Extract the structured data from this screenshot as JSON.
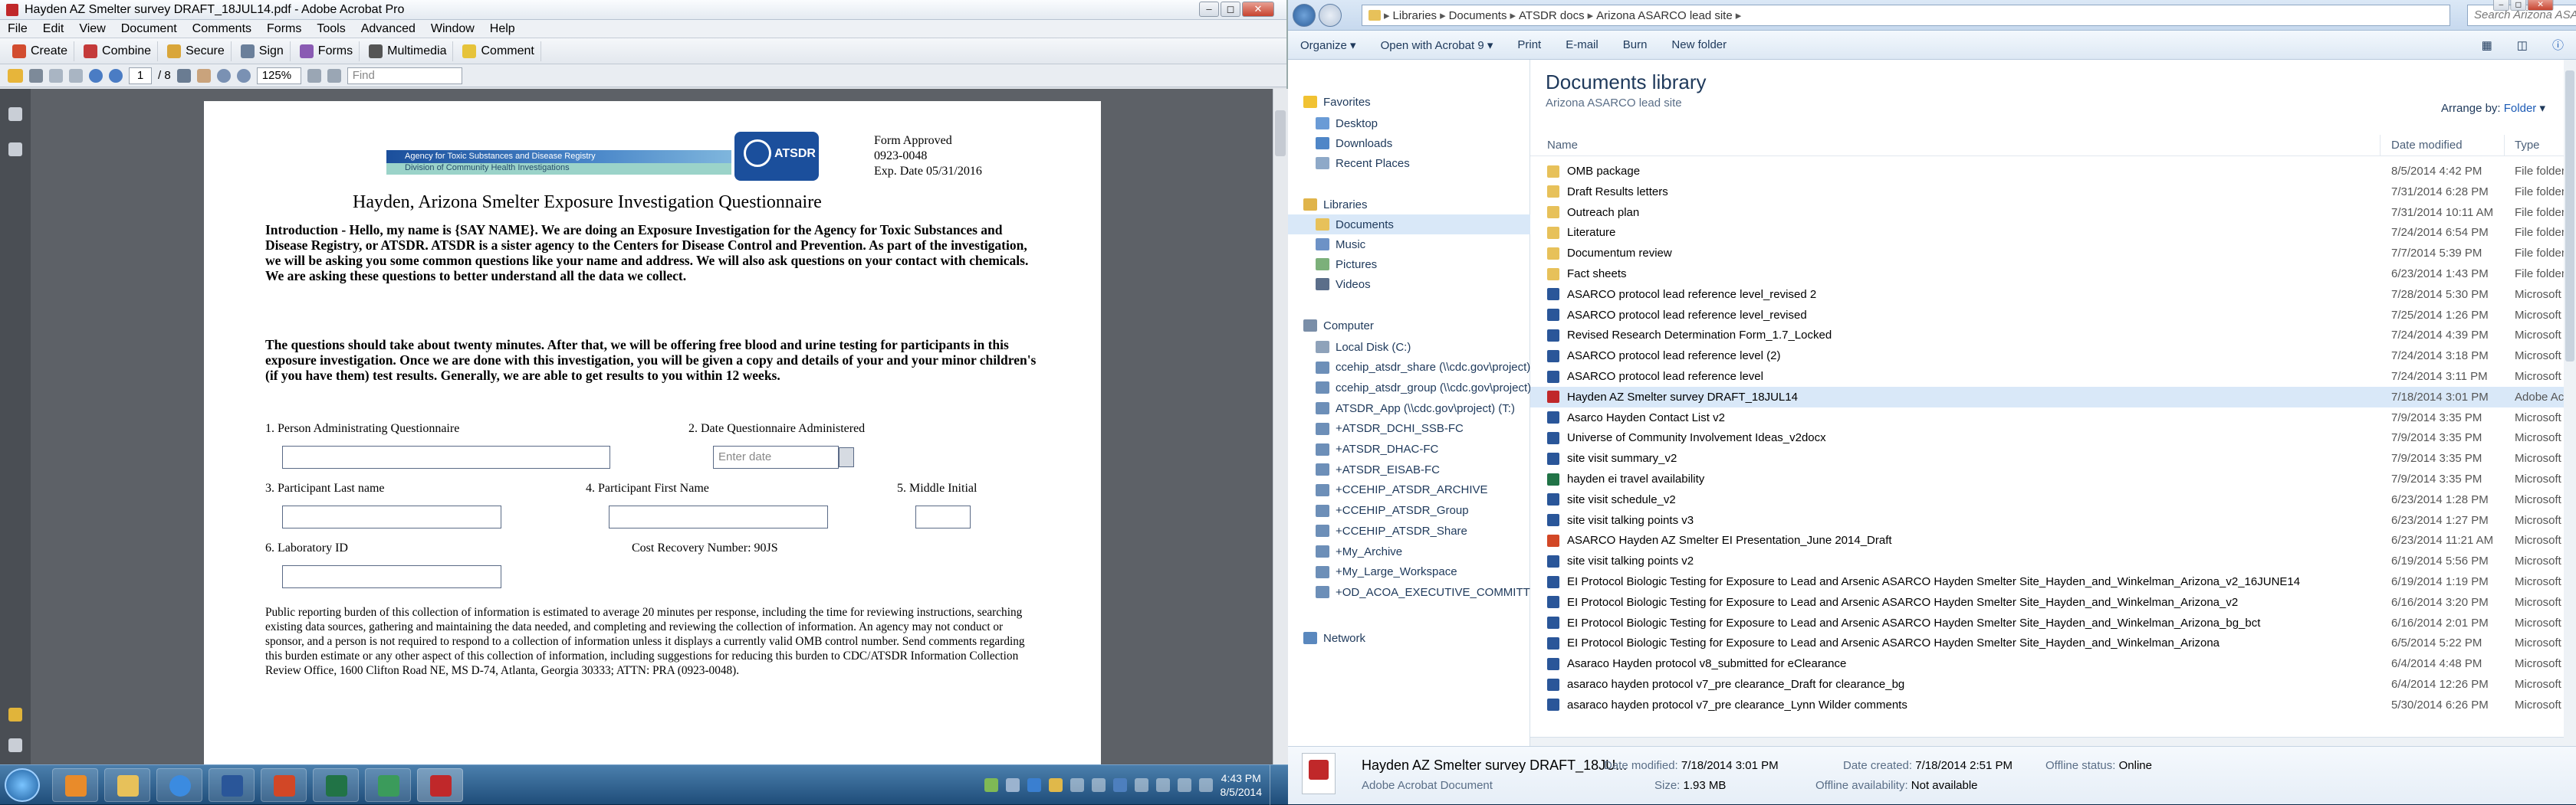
{
  "acrobat": {
    "title": "Hayden AZ Smelter survey DRAFT_18JUL14.pdf - Adobe Acrobat Pro",
    "menu": [
      "File",
      "Edit",
      "View",
      "Document",
      "Comments",
      "Forms",
      "Tools",
      "Advanced",
      "Window",
      "Help"
    ],
    "toolbar": [
      "Create",
      "Combine",
      "Secure",
      "Sign",
      "Forms",
      "Multimedia",
      "Comment"
    ],
    "page_current": "1",
    "page_total": "/ 8",
    "zoom": "125%",
    "find_placeholder": "Find"
  },
  "pdf": {
    "agency_line1": "Agency for Toxic Substances and Disease Registry",
    "agency_line2": "Division of Community Health Investigations",
    "logo_text": "ATSDR",
    "form_approved": "Form Approved",
    "omb": "0923-0048",
    "exp": "Exp. Date 05/31/2016",
    "title": "Hayden, Arizona Smelter Exposure Investigation Questionnaire",
    "intro": "Introduction - Hello, my name is {SAY NAME}. We are doing an Exposure Investigation for the Agency for Toxic Substances and Disease Registry, or ATSDR. ATSDR is a sister agency to the Centers for Disease Control and Prevention. As part of the investigation, we will be asking you some common questions like your name and address. We will also ask questions on your contact with chemicals. We are asking these questions to better understand all the data we collect.",
    "para2": "The questions should take about twenty minutes. After that, we will be offering free blood and urine testing for participants in this exposure investigation. Once we are done with this investigation, you will be given a copy and details of your and your minor children's (if you have them) test results. Generally, we are able to get results to you within 12 weeks.",
    "q1": "1.  Person Administrating Questionnaire",
    "q2": "2.  Date Questionnaire Administered",
    "date_placeholder": "Enter date",
    "q3": "3.  Participant Last name",
    "q4": "4.  Participant First Name",
    "q5": "5.  Middle Initial",
    "q6": "6.  Laboratory ID",
    "cost": "Cost Recovery Number: 90JS",
    "burden": "Public reporting burden of this collection of information is estimated to average 20 minutes per response, including the time for reviewing instructions, searching existing data sources, gathering and maintaining the data needed, and completing and reviewing the collection of information. An agency may not conduct or sponsor, and a person is not required to respond to a collection of information unless it displays a currently valid OMB control number. Send comments regarding this burden estimate or any other aspect of this collection of information, including suggestions for reducing this burden to CDC/ATSDR Information Collection Review Office, 1600 Clifton Road NE, MS D-74, Atlanta, Georgia 30333; ATTN: PRA (0923-0048)."
  },
  "explorer": {
    "breadcrumb": [
      "Libraries",
      "Documents",
      "ATSDR docs",
      "Arizona ASARCO lead site"
    ],
    "search_placeholder": "Search Arizona ASARCO lead ...",
    "commands": [
      "Organize",
      "Open with Acrobat 9",
      "Print",
      "E-mail",
      "Burn",
      "New folder"
    ],
    "nav": {
      "favorites": "Favorites",
      "fav_items": [
        "Desktop",
        "Downloads",
        "Recent Places"
      ],
      "libraries": "Libraries",
      "lib_items": [
        "Documents",
        "Music",
        "Pictures",
        "Videos"
      ],
      "computer": "Computer",
      "comp_items": [
        "Local Disk (C:)",
        "ccehip_atsdr_share (\\\\cdc.gov\\project)",
        "ccehip_atsdr_group (\\\\cdc.gov\\project)",
        "ATSDR_App (\\\\cdc.gov\\project) (T:)",
        "+ATSDR_DCHI_SSB-FC",
        "+ATSDR_DHAC-FC",
        "+ATSDR_EISAB-FC",
        "+CCEHIP_ATSDR_ARCHIVE",
        "+CCEHIP_ATSDR_Group",
        "+CCEHIP_ATSDR_Share",
        "+My_Archive",
        "+My_Large_Workspace",
        "+OD_ACOA_EXECUTIVE_COMMITTEE-"
      ],
      "network": "Network"
    },
    "library_title": "Documents library",
    "library_sub": "Arizona ASARCO lead site",
    "arrange_label": "Arrange by:",
    "arrange_value": "Folder",
    "columns": {
      "name": "Name",
      "date": "Date modified",
      "type": "Type"
    },
    "files": [
      {
        "name": "OMB package",
        "date": "8/5/2014 4:42 PM",
        "type": "File folder",
        "kind": "folder"
      },
      {
        "name": "Draft Results letters",
        "date": "7/31/2014 6:28 PM",
        "type": "File folder",
        "kind": "folder"
      },
      {
        "name": "Outreach plan",
        "date": "7/31/2014 10:11 AM",
        "type": "File folder",
        "kind": "folder"
      },
      {
        "name": "Literature",
        "date": "7/24/2014 6:54 PM",
        "type": "File folder",
        "kind": "folder"
      },
      {
        "name": "Documentum review",
        "date": "7/7/2014 5:39 PM",
        "type": "File folder",
        "kind": "folder"
      },
      {
        "name": "Fact sheets",
        "date": "6/23/2014 1:43 PM",
        "type": "File folder",
        "kind": "folder"
      },
      {
        "name": "ASARCO protocol lead reference level_revised 2",
        "date": "7/28/2014 5:30 PM",
        "type": "Microsoft",
        "kind": "word"
      },
      {
        "name": "ASARCO protocol lead reference level_revised",
        "date": "7/25/2014 1:26 PM",
        "type": "Microsoft",
        "kind": "word"
      },
      {
        "name": "Revised Research Determination Form_1.7_Locked",
        "date": "7/24/2014 4:39 PM",
        "type": "Microsoft",
        "kind": "word"
      },
      {
        "name": "ASARCO protocol lead reference level (2)",
        "date": "7/24/2014 3:18 PM",
        "type": "Microsoft",
        "kind": "word"
      },
      {
        "name": "ASARCO protocol lead reference level",
        "date": "7/24/2014 3:11 PM",
        "type": "Microsoft",
        "kind": "word"
      },
      {
        "name": "Hayden AZ Smelter survey DRAFT_18JUL14",
        "date": "7/18/2014 3:01 PM",
        "type": "Adobe Acrobat",
        "kind": "pdf",
        "selected": true
      },
      {
        "name": "Asarco Hayden Contact List v2",
        "date": "7/9/2014 3:35 PM",
        "type": "Microsoft",
        "kind": "word"
      },
      {
        "name": "Universe of Community Involvement Ideas_v2docx",
        "date": "7/9/2014 3:35 PM",
        "type": "Microsoft",
        "kind": "word"
      },
      {
        "name": "site visit summary_v2",
        "date": "7/9/2014 3:35 PM",
        "type": "Microsoft",
        "kind": "word"
      },
      {
        "name": "hayden ei travel availability",
        "date": "7/9/2014 3:35 PM",
        "type": "Microsoft",
        "kind": "excel"
      },
      {
        "name": "site visit schedule_v2",
        "date": "6/23/2014 1:28 PM",
        "type": "Microsoft",
        "kind": "word"
      },
      {
        "name": "site visit talking points v3",
        "date": "6/23/2014 1:27 PM",
        "type": "Microsoft",
        "kind": "word"
      },
      {
        "name": "ASARCO Hayden AZ Smelter EI Presentation_June 2014_Draft",
        "date": "6/23/2014 11:21 AM",
        "type": "Microsoft",
        "kind": "ppt"
      },
      {
        "name": "site visit talking points v2",
        "date": "6/19/2014 5:56 PM",
        "type": "Microsoft",
        "kind": "word"
      },
      {
        "name": "EI Protocol Biologic Testing for Exposure to Lead and Arsenic ASARCO Hayden Smelter Site_Hayden_and_Winkelman_Arizona_v2_16JUNE14",
        "date": "6/19/2014 1:19 PM",
        "type": "Microsoft",
        "kind": "word"
      },
      {
        "name": "EI Protocol Biologic Testing for Exposure to Lead and Arsenic ASARCO Hayden Smelter Site_Hayden_and_Winkelman_Arizona_v2",
        "date": "6/16/2014 3:20 PM",
        "type": "Microsoft",
        "kind": "word"
      },
      {
        "name": "EI Protocol Biologic Testing for Exposure to Lead and Arsenic ASARCO Hayden Smelter Site_Hayden_and_Winkelman_Arizona_bg_bct",
        "date": "6/16/2014 2:01 PM",
        "type": "Microsoft",
        "kind": "word"
      },
      {
        "name": "EI Protocol Biologic Testing for Exposure to Lead and Arsenic ASARCO Hayden Smelter Site_Hayden_and_Winkelman_Arizona",
        "date": "6/5/2014 5:22 PM",
        "type": "Microsoft",
        "kind": "word"
      },
      {
        "name": "Asaraco Hayden protocol v8_submitted for eClearance",
        "date": "6/4/2014 4:48 PM",
        "type": "Microsoft",
        "kind": "word"
      },
      {
        "name": "asaraco hayden protocol v7_pre clearance_Draft for clearance_bg",
        "date": "6/4/2014 12:26 PM",
        "type": "Microsoft",
        "kind": "word"
      },
      {
        "name": "asaraco hayden protocol v7_pre clearance_Lynn Wilder comments",
        "date": "5/30/2014 6:26 PM",
        "type": "Microsoft",
        "kind": "word"
      }
    ],
    "details": {
      "name": "Hayden AZ Smelter survey DRAFT_18JU...",
      "type": "Adobe Acrobat Document",
      "modified_label": "Date modified:",
      "modified": "7/18/2014 3:01 PM",
      "size_label": "Size:",
      "size": "1.93 MB",
      "created_label": "Date created:",
      "created": "7/18/2014 2:51 PM",
      "avail_label": "Offline availability:",
      "avail": "Not available",
      "status_label": "Offline status:",
      "status": "Online"
    }
  },
  "taskbar": {
    "time": "4:43 PM",
    "date": "8/5/2014"
  },
  "colors": {
    "accent": "#1e395b",
    "select": "#d9e8f8",
    "atsdr_blue": "#1b4f9c"
  }
}
